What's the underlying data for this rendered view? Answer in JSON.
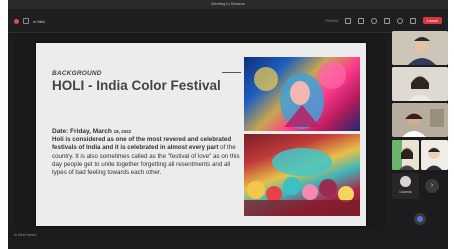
{
  "window": {
    "title": "Meeting in Session"
  },
  "toolbar": {
    "meeting_label": "in Mtst",
    "right_label": "Rfdebd",
    "leave_label": "Leave"
  },
  "slide": {
    "kicker": "BACKGROUND",
    "title": "HOLI - India Color Festival",
    "date_prefix": "Date: Friday, March",
    "date_small": "18, 2022",
    "body_bold_1": "Holi is considered as one of the most revered and celebrated festivals of India and it is celebrated in almost every part",
    "body_normal_1": "of the country. It is also sometimes called as the \"festival of love\" as on this day people get to unite together forgetting all resentments and all types of bad feeling towards each other."
  },
  "participants": {
    "avatar_name": "Lisamia"
  },
  "status_bar": {
    "text": "In Meet noisex"
  },
  "colors": {
    "slide_bg": "#ececec",
    "title_gray": "#444444",
    "leave_red": "#d9363e",
    "app_dark": "#1c1c1e"
  }
}
